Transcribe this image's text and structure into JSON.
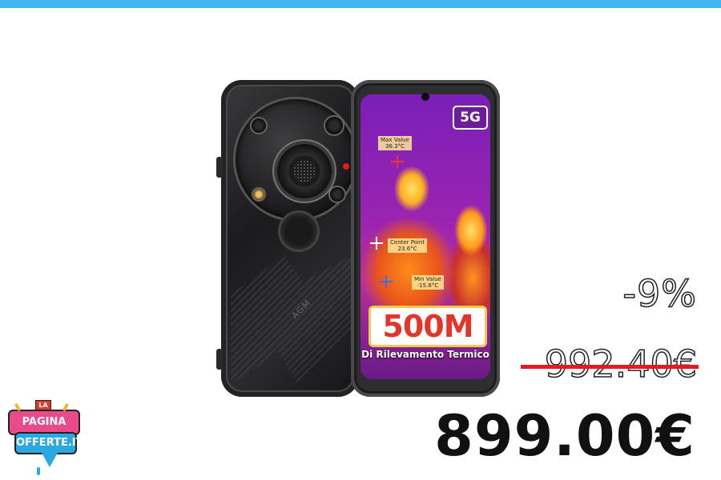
{
  "product": {
    "screen_badge": "5G",
    "max_label": "Max Value",
    "max_value": "36.3°C",
    "center_label": "Center Point",
    "center_value": "23.6°C",
    "min_label": "Min Value",
    "min_value": "-15.6°C",
    "headline": "500M",
    "caption": "Di Rilevamento Termico",
    "back_brand": "AGM"
  },
  "pricing": {
    "discount": "-9%",
    "old_price": "992.40€",
    "new_price": "899.00€"
  },
  "logo": {
    "top": "LA",
    "line1": "PAGINA DELLE",
    "line2": "OFFERTE.IT"
  },
  "colors": {
    "topbar": "#3fb6ef",
    "strike": "#e11b22",
    "headline": "#e3352a"
  }
}
